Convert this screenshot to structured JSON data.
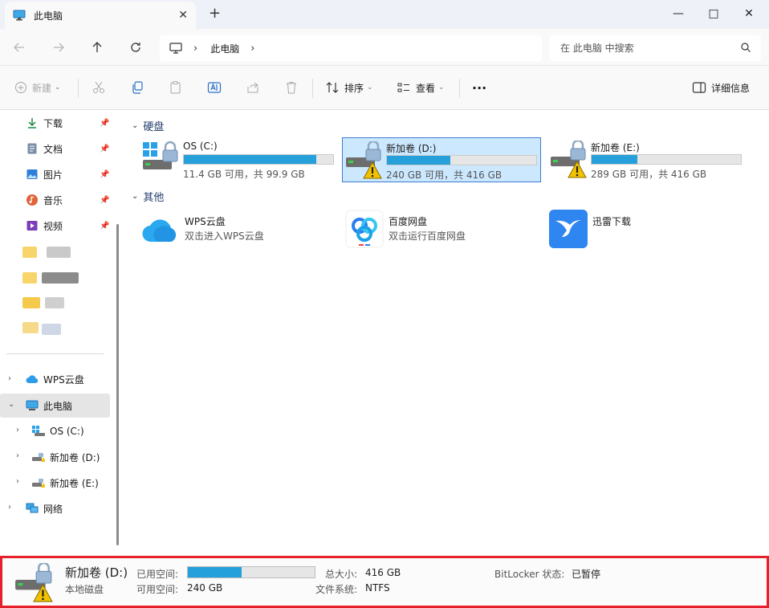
{
  "titlebar": {
    "tab_title": "此电脑",
    "new_tab": "+",
    "minimize": "—",
    "maximize": "□",
    "close": "✕"
  },
  "address": {
    "crumb": "此电脑",
    "search_placeholder": "在 此电脑 中搜索"
  },
  "commandbar": {
    "new_label": "新建",
    "sort_label": "排序",
    "view_label": "查看",
    "more_label": "···",
    "details_label": "详细信息"
  },
  "sidebar": {
    "quick": [
      {
        "label": "下载",
        "icon": "download-icon"
      },
      {
        "label": "文档",
        "icon": "document-icon"
      },
      {
        "label": "图片",
        "icon": "picture-icon"
      },
      {
        "label": "音乐",
        "icon": "music-icon"
      },
      {
        "label": "视频",
        "icon": "video-icon"
      }
    ],
    "tree": [
      {
        "label": "WPS云盘"
      },
      {
        "label": "此电脑"
      },
      {
        "label": "OS (C:)"
      },
      {
        "label": "新加卷 (D:)"
      },
      {
        "label": "新加卷 (E:)"
      },
      {
        "label": "网络"
      }
    ]
  },
  "content": {
    "group_drives": "硬盘",
    "group_other": "其他",
    "drives": [
      {
        "name": "OS (C:)",
        "free_text": "11.4 GB 可用，共 99.9 GB",
        "used_fraction": 0.886
      },
      {
        "name": "新加卷 (D:)",
        "free_text": "240 GB 可用，共 416 GB",
        "used_fraction": 0.423
      },
      {
        "name": "新加卷 (E:)",
        "free_text": "289 GB 可用，共 416 GB",
        "used_fraction": 0.305
      }
    ],
    "apps": [
      {
        "name": "WPS云盘",
        "sub": "双击进入WPS云盘"
      },
      {
        "name": "百度网盘",
        "sub": "双击运行百度网盘"
      },
      {
        "name": "迅雷下载",
        "sub": ""
      }
    ]
  },
  "details": {
    "name": "新加卷 (D:)",
    "type": "本地磁盘",
    "used_label": "已用空间:",
    "free_label": "可用空间:",
    "free_value": "240 GB",
    "used_fraction": 0.423,
    "total_label": "总大小:",
    "total_value": "416 GB",
    "fs_label": "文件系统:",
    "fs_value": "NTFS",
    "bitlocker_label": "BitLocker 状态:",
    "bitlocker_value": "已暂停"
  },
  "colors": {
    "accent": "#26a0da",
    "selection": "#cce8ff",
    "highlight_border": "#e5202a"
  }
}
